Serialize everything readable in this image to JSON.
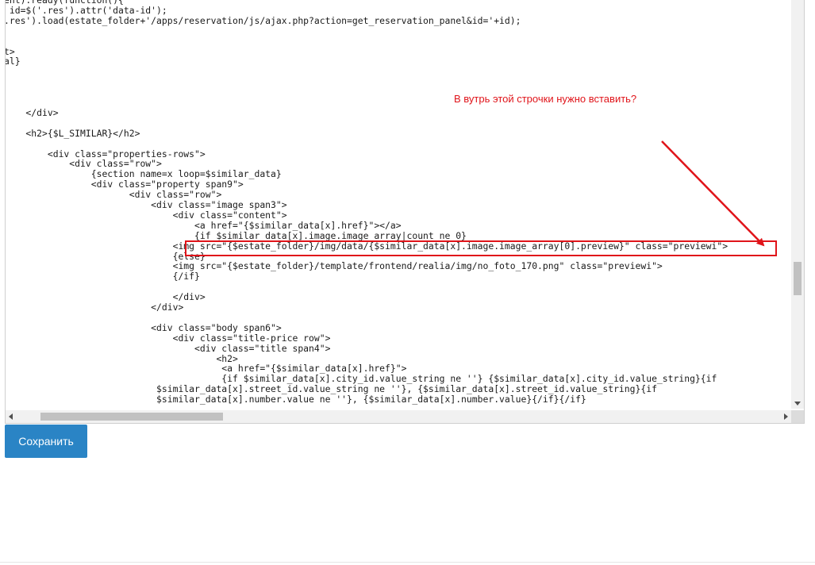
{
  "code_lines": [
    "ent).ready(function(){",
    " id=$('.res').attr('data-id');",
    ".res').load(estate_folder+'/apps/reservation/js/ajax.php?action=get_reservation_panel&id='+id);",
    "",
    "",
    "t>",
    "al}",
    "",
    "",
    "",
    "",
    "    </div>",
    "",
    "    <h2>{$L_SIMILAR}</h2>",
    "",
    "        <div class=\"properties-rows\">",
    "            <div class=\"row\">",
    "                {section name=x loop=$similar_data}",
    "                <div class=\"property span9\">",
    "                       <div class=\"row\">",
    "                           <div class=\"image span3\">",
    "                               <div class=\"content\">",
    "                                   <a href=\"{$similar_data[x].href}\"></a>",
    "                                   {if $similar_data[x].image.image_array|count ne 0}",
    "                               <img src=\"{$estate_folder}/img/data/{$similar_data[x].image.image_array[0].preview}\" class=\"previewi\">",
    "                               {else}",
    "                               <img src=\"{$estate_folder}/template/frontend/realia/img/no_foto_170.png\" class=\"previewi\">",
    "                               {/if}",
    "",
    "                               </div>",
    "                           </div>",
    "",
    "                           <div class=\"body span6\">",
    "                               <div class=\"title-price row\">",
    "                                   <div class=\"title span4\">",
    "                                       <h2>",
    "                                        <a href=\"{$similar_data[x].href}\">",
    "                                        {if $similar_data[x].city_id.value_string ne ''} {$similar_data[x].city_id.value_string}{if",
    "                            $similar_data[x].street_id.value_string ne ''}, {$similar_data[x].street_id.value_string}{if",
    "                            $similar_data[x].number.value ne ''}, {$similar_data[x].number.value}{/if}{/if}"
  ],
  "annotation": {
    "text": "В вутрь этой строчки нужно вставить?",
    "color": "#e0141a"
  },
  "save_button": {
    "label": "Сохранить",
    "color": "#2a84c5"
  },
  "scroll": {
    "vertical_position": 0.66,
    "horizontal_position": 0.05
  }
}
